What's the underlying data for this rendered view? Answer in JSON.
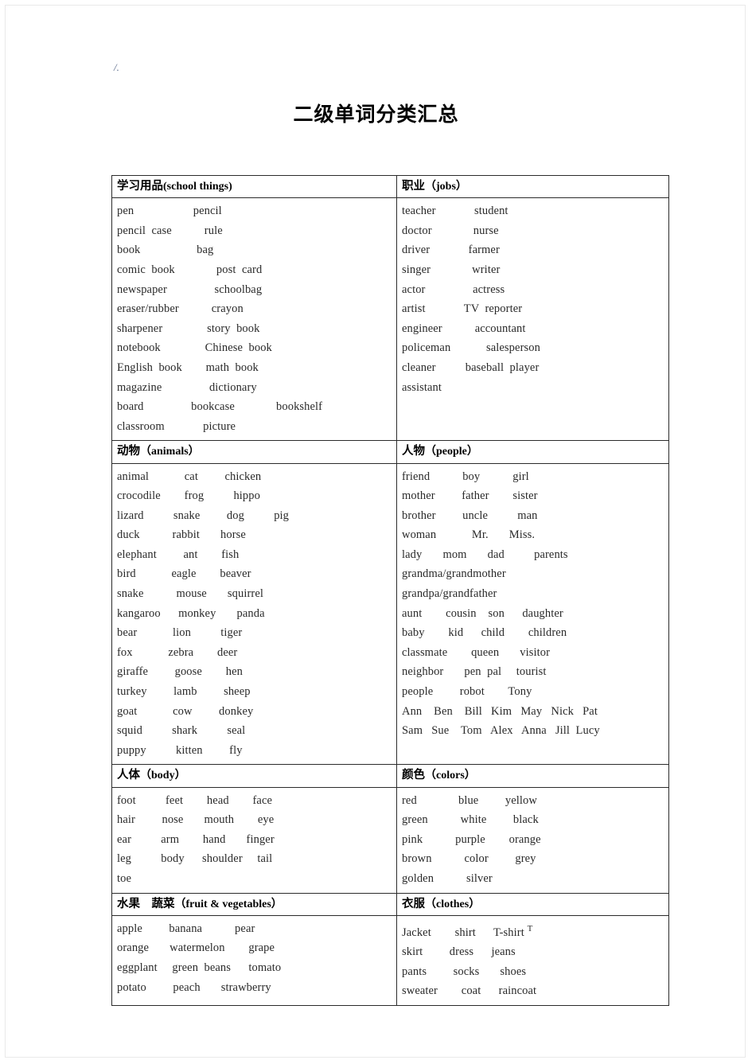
{
  "page": {
    "corner_mark": "/.",
    "title": "二级单词分类汇总"
  },
  "table": {
    "sections": [
      {
        "left": {
          "heading_cn": "学习用品",
          "heading_en": "(school  things)",
          "rows": [
            "pen                    pencil",
            "pencil  case           rule",
            "book                   bag",
            "comic  book              post  card",
            "newspaper                schoolbag",
            "eraser/rubber           crayon",
            "sharpener               story  book",
            "notebook               Chinese  book",
            "English  book        math  book",
            "magazine                dictionary",
            "board                bookcase              bookshelf",
            "classroom             picture"
          ]
        },
        "right": {
          "heading_cn": "职业",
          "heading_en": "（jobs）",
          "rows": [
            "teacher             student",
            "doctor              nurse",
            "driver             farmer",
            "singer              writer",
            "actor                actress",
            "artist             TV  reporter",
            "engineer           accountant",
            "policeman            salesperson",
            "cleaner          baseball  player",
            "assistant"
          ]
        }
      },
      {
        "left": {
          "heading_cn": "动物",
          "heading_en": "（animals）",
          "rows": [
            "animal            cat         chicken",
            "crocodile        frog          hippo",
            "lizard          snake         dog          pig",
            "duck           rabbit       horse",
            "elephant         ant        fish",
            "bird            eagle        beaver",
            "snake           mouse       squirrel",
            "kangaroo      monkey       panda",
            "bear            lion          tiger",
            "fox            zebra        deer",
            "giraffe         goose        hen",
            "turkey         lamb         sheep",
            "goat            cow         donkey",
            "squid          shark          seal",
            "puppy          kitten         fly"
          ]
        },
        "right": {
          "heading_cn": "人物",
          "heading_en": "（people）",
          "rows": [
            "friend           boy           girl",
            "mother         father        sister",
            "brother         uncle          man",
            "woman            Mr.       Miss.",
            "lady       mom       dad          parents",
            "grandma/grandmother",
            "grandpa/grandfather",
            "aunt        cousin    son      daughter",
            "baby        kid      child        children",
            "classmate        queen       visitor",
            "neighbor       pen  pal     tourist",
            "people         robot        Tony",
            "Ann    Ben    Bill   Kim   May   Nick   Pat",
            "Sam   Sue    Tom   Alex   Anna   Jill  Lucy"
          ]
        }
      },
      {
        "left": {
          "heading_cn": "人体",
          "heading_en": "（body）",
          "rows": [
            "foot          feet        head        face",
            "hair         nose       mouth        eye",
            "ear          arm        hand       finger",
            "leg          body      shoulder     tail",
            "toe"
          ]
        },
        "right": {
          "heading_cn": "颜色",
          "heading_en": "（colors）",
          "rows": [
            "red              blue         yellow",
            "green           white         black",
            "pink           purple        orange",
            "brown           color         grey",
            "golden           silver"
          ]
        }
      },
      {
        "left": {
          "heading_cn": "水果　蔬菜",
          "heading_en": "（fruit  &  vegetables）",
          "rows": [
            "apple         banana           pear",
            "orange       watermelon        grape",
            "eggplant     green  beans      tomato",
            "potato         peach       strawberry"
          ]
        },
        "right": {
          "heading_cn": "衣服",
          "heading_en": "（clothes）",
          "rows": [
            "Jacket        shirt      T-shirt ",
            "skirt         dress      jeans",
            "pants         socks       shoes",
            "sweater        coat      raincoat"
          ],
          "superscript_row_index": 0,
          "superscript_text": "T"
        }
      }
    ]
  }
}
